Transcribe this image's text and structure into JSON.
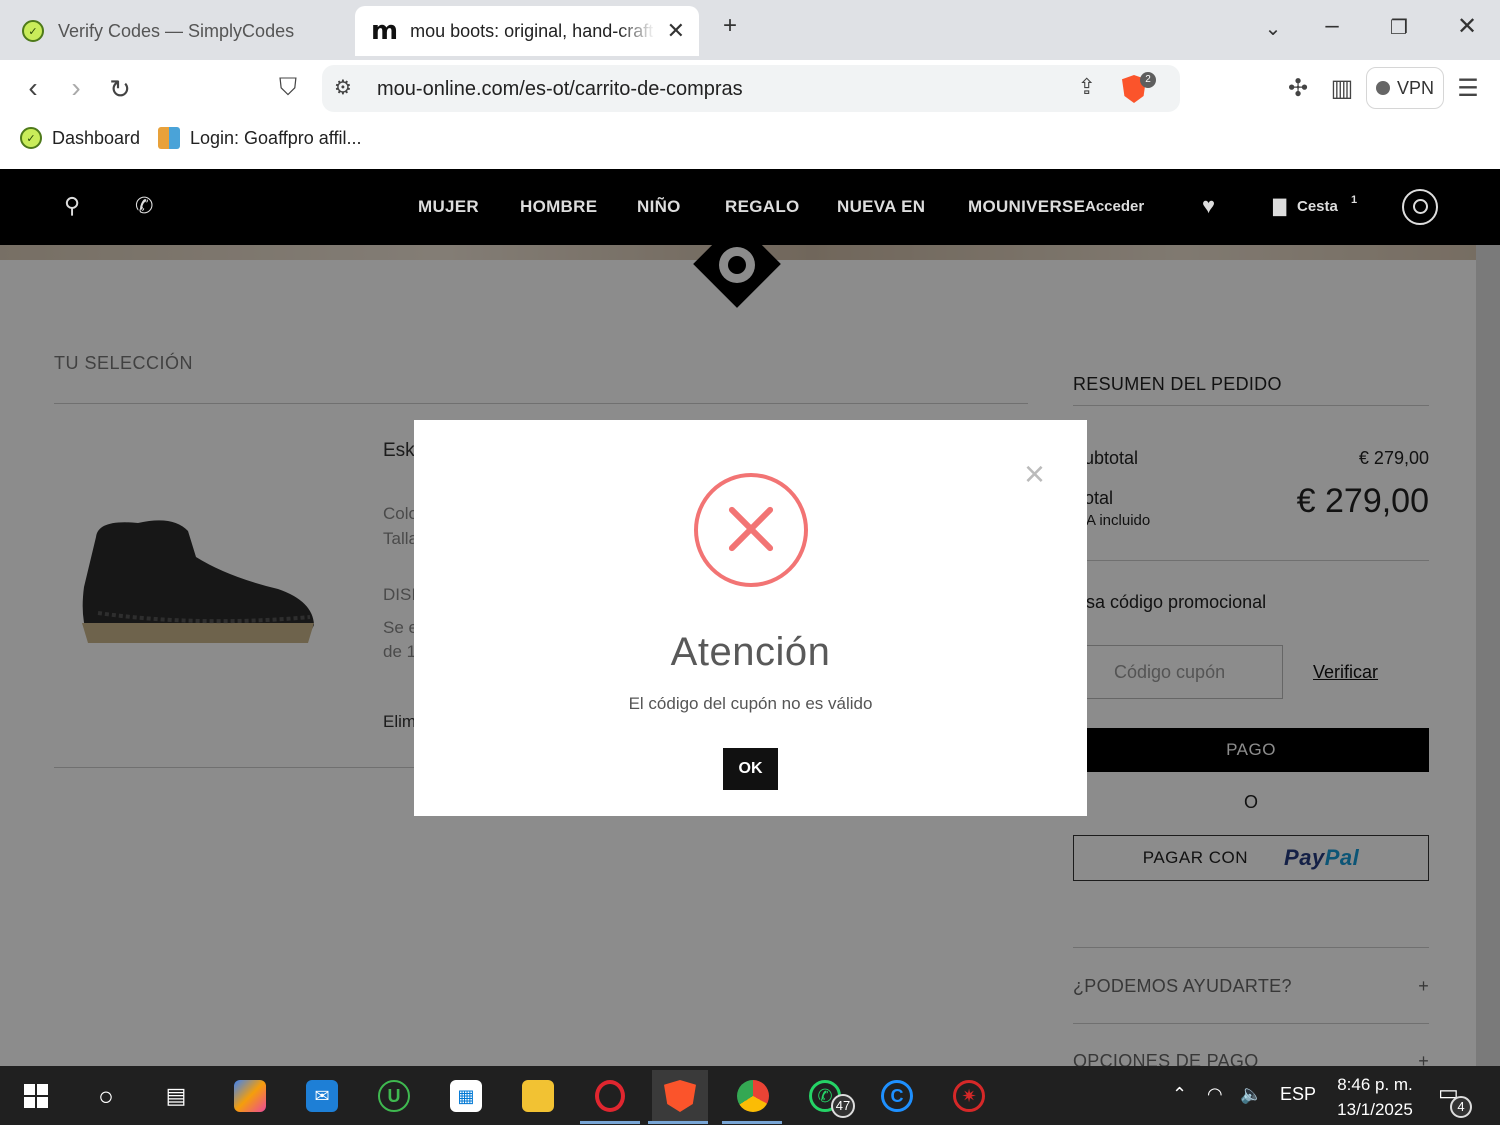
{
  "browser": {
    "tabs": [
      {
        "title": "Verify Codes — SimplyCodes",
        "active": false
      },
      {
        "title": "mou boots: original, hand-craft",
        "active": true
      }
    ],
    "url": "mou-online.com/es-ot/carrito-de-compras",
    "shield_count": "2",
    "vpn_label": "VPN",
    "bookmarks": [
      {
        "label": "Dashboard"
      },
      {
        "label": "Login: Goaffpro affil..."
      }
    ]
  },
  "site": {
    "nav": [
      "MUJER",
      "HOMBRE",
      "NIÑO",
      "REGALO",
      "NUEVA EN",
      "MOUNIVERSE"
    ],
    "login_label": "Acceder",
    "cart_label": "Cesta",
    "cart_count": "1"
  },
  "selection": {
    "title": "TU SELECCIÓN",
    "product_name": "Eski",
    "color_label": "Colo",
    "size_label": "Talla",
    "availability_label": "DISI",
    "shipping_line1": "Se e",
    "shipping_line2": "de 1",
    "remove_label": "Elim"
  },
  "summary": {
    "title": "RESUMEN DEL PEDIDO",
    "subtotal_label": "ubtotal",
    "subtotal_value": "€ 279,00",
    "total_label": "otal",
    "vat_label": "A incluido",
    "total_value": "€ 279,00",
    "promo_label": "sa código promocional",
    "coupon_placeholder": "Código cupón",
    "verify_label": "Verificar",
    "pay_button": "PAGO",
    "or_label": "O",
    "paypal_button": "PAGAR CON",
    "paypal_brand_a": "Pay",
    "paypal_brand_b": "Pal"
  },
  "help": {
    "items": [
      "¿PODEMOS AYUDARTE?",
      "OPCIONES DE PAGO"
    ]
  },
  "modal": {
    "title": "Atención",
    "message": "El código del cupón no es válido",
    "ok_label": "OK",
    "close_symbol": "×",
    "accent_color": "#f27474"
  },
  "taskbar": {
    "language": "ESP",
    "time": "8:46 p. m.",
    "date": "13/1/2025",
    "whatsapp_badge": "47",
    "notifications_badge": "4"
  }
}
